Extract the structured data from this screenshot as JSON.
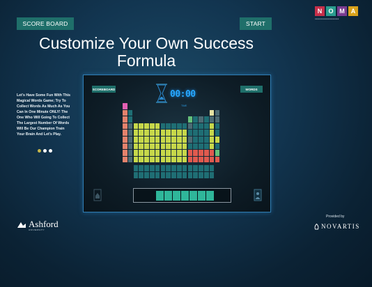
{
  "header": {
    "scoreboard_label": "SCORE BOARD",
    "start_label": "START",
    "title_line1": "Customize Your Own Success",
    "title_line2": "Formula"
  },
  "logo": {
    "letters": [
      "N",
      "O",
      "M",
      "A"
    ],
    "colors": [
      "#c62f4a",
      "#2a9d8f",
      "#7a3c91",
      "#d9a21b"
    ]
  },
  "intro_text": "Let's Have Some Fun With This Magical Words Game; Try To Collect Words As Much As You Can In One Minute ONLY! The One Who Will Going To Collect The Largest Number Of Words Will Be Our Champion Train Your Brain And Let's Play.",
  "carousel": {
    "count": 3,
    "active_index": 0
  },
  "game": {
    "scoreboard_label": "SCOREBOARD",
    "words_label": "WORDS",
    "timer": "00:00",
    "timer_label": "TIME",
    "word_slots": 7
  },
  "footer": {
    "ashford_name": "Ashford",
    "ashford_sub": "UNIVERSITY",
    "provided_by": "Provided by",
    "novartis_name": "NOVARTIS"
  },
  "colors": {
    "accent": "#1f6f6a",
    "frame_border": "#2f7db3",
    "timer": "#27a8ff",
    "slot": "#2fb69a"
  }
}
